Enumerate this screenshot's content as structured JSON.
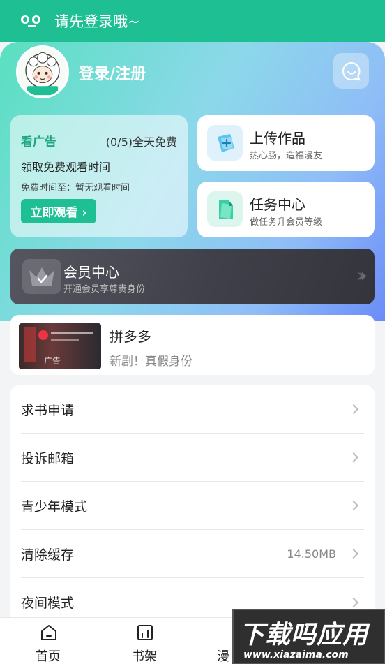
{
  "status_bar": {
    "text": "请先登录哦~"
  },
  "profile": {
    "login_label": "登录/注册",
    "avatar_text": "小肥羊"
  },
  "ad_card": {
    "title": "看广告",
    "count": "(0/5)全天免费",
    "desc": "领取免费观看时间",
    "free_time": "免费时间至：暂无观看时间",
    "button": "立即观看 ›"
  },
  "upload": {
    "title": "上传作品",
    "subtitle": "热心肠，造福漫友"
  },
  "tasks": {
    "title": "任务中心",
    "subtitle": "做任务升会员等级"
  },
  "vip": {
    "title": "会员中心",
    "subtitle": "开通会员享尊贵身份",
    "arrows": "›››"
  },
  "ad_banner": {
    "thumb_label": "广告",
    "title": "拼多多",
    "subtitle": "新剧！真假身份"
  },
  "menu": [
    {
      "label": "求书申请",
      "value": ""
    },
    {
      "label": "投诉邮箱",
      "value": ""
    },
    {
      "label": "青少年模式",
      "value": ""
    },
    {
      "label": "清除缓存",
      "value": "14.50MB"
    },
    {
      "label": "夜间模式",
      "value": ""
    }
  ],
  "tabs": [
    {
      "label": "首页",
      "icon": "home-icon"
    },
    {
      "label": "书架",
      "icon": "bookshelf-icon"
    },
    {
      "label": "漫",
      "icon": "comic-icon"
    }
  ],
  "watermark": {
    "big": "下载吗应用",
    "small": "www.xiazaima.com"
  },
  "colors": {
    "accent": "#1fbf94",
    "vip_bg": "#3f4049"
  }
}
